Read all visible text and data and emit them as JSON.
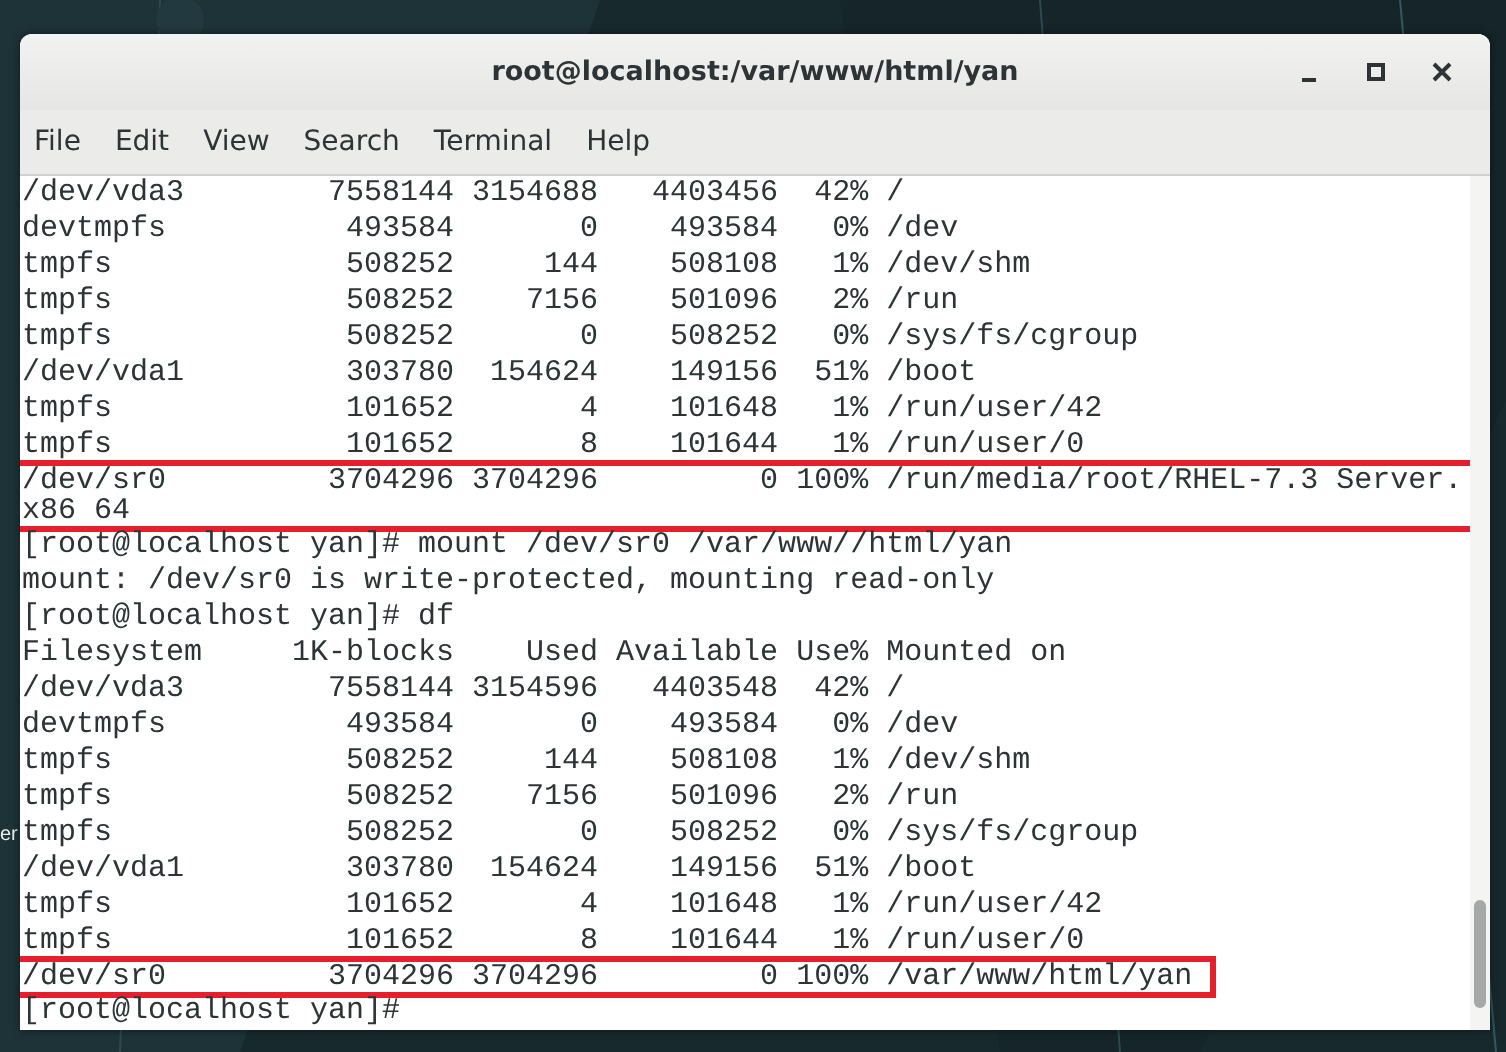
{
  "desktop": {
    "label": "er"
  },
  "window": {
    "title": "root@localhost:/var/www/html/yan"
  },
  "menu": [
    "File",
    "Edit",
    "View",
    "Search",
    "Terminal",
    "Help"
  ],
  "terminal": {
    "blocks": [
      {
        "kind": "text",
        "text": "/dev/vda3        7558144 3154688   4403456  42% /"
      },
      {
        "kind": "text",
        "text": "devtmpfs          493584       0    493584   0% /dev"
      },
      {
        "kind": "text",
        "text": "tmpfs             508252     144    508108   1% /dev/shm"
      },
      {
        "kind": "text",
        "text": "tmpfs             508252    7156    501096   2% /run"
      },
      {
        "kind": "text",
        "text": "tmpfs             508252       0    508252   0% /sys/fs/cgroup"
      },
      {
        "kind": "text",
        "text": "/dev/vda1         303780  154624    149156  51% /boot"
      },
      {
        "kind": "text",
        "text": "tmpfs             101652       4    101648   1% /run/user/42"
      },
      {
        "kind": "text",
        "text": "tmpfs             101652       8    101644   1% /run/user/0"
      },
      {
        "kind": "highlight",
        "lines": [
          "/dev/sr0         3704296 3704296         0 100% /run/media/root/RHEL-7.3 Server.",
          "x86 64"
        ]
      },
      {
        "kind": "text",
        "text": "[root@localhost yan]# mount /dev/sr0 /var/www//html/yan"
      },
      {
        "kind": "text",
        "text": "mount: /dev/sr0 is write-protected, mounting read-only"
      },
      {
        "kind": "text",
        "text": "[root@localhost yan]# df"
      },
      {
        "kind": "text",
        "text": "Filesystem     1K-blocks    Used Available Use% Mounted on"
      },
      {
        "kind": "text",
        "text": "/dev/vda3        7558144 3154596   4403548  42% /"
      },
      {
        "kind": "text",
        "text": "devtmpfs          493584       0    493584   0% /dev"
      },
      {
        "kind": "text",
        "text": "tmpfs             508252     144    508108   1% /dev/shm"
      },
      {
        "kind": "text",
        "text": "tmpfs             508252    7156    501096   2% /run"
      },
      {
        "kind": "text",
        "text": "tmpfs             508252       0    508252   0% /sys/fs/cgroup"
      },
      {
        "kind": "text",
        "text": "/dev/vda1         303780  154624    149156  51% /boot"
      },
      {
        "kind": "text",
        "text": "tmpfs             101652       4    101648   1% /run/user/42"
      },
      {
        "kind": "text",
        "text": "tmpfs             101652       8    101644   1% /run/user/0"
      },
      {
        "kind": "highlight",
        "lines": [
          "/dev/sr0         3704296 3704296         0 100% /var/www/html/yan"
        ]
      },
      {
        "kind": "text",
        "text": "[root@localhost yan]#"
      }
    ]
  }
}
